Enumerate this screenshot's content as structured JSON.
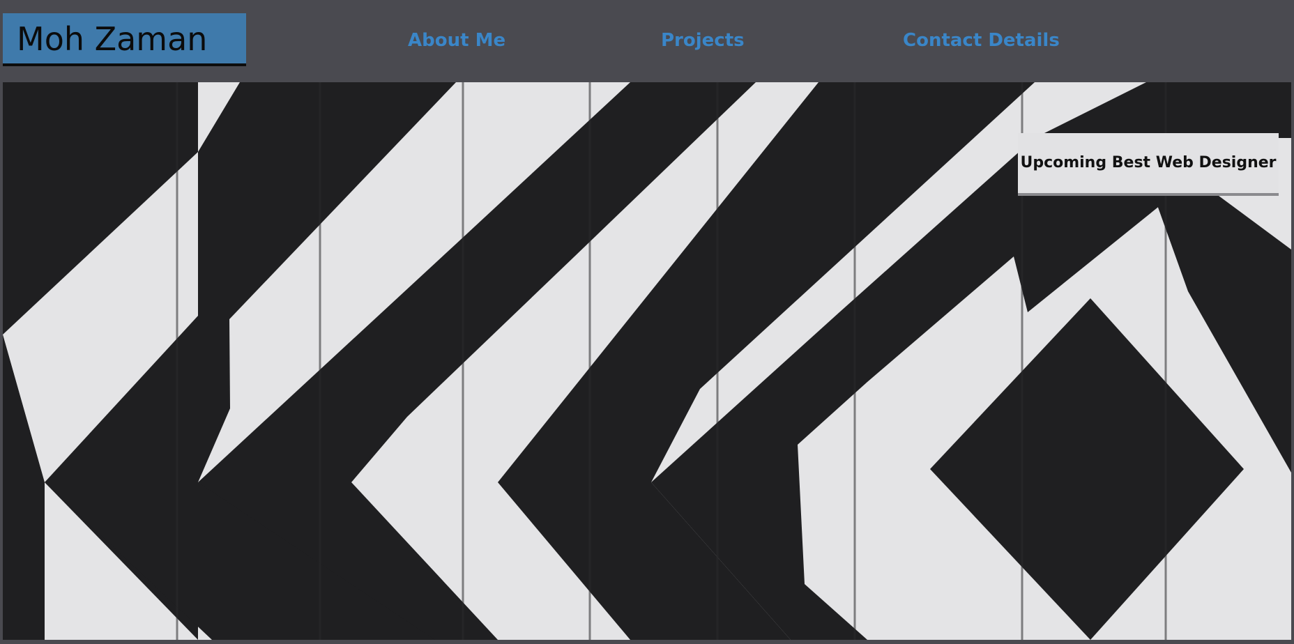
{
  "brand": {
    "name": "Moh Zaman"
  },
  "nav": {
    "items": [
      {
        "label": "About Me"
      },
      {
        "label": "Projects"
      },
      {
        "label": "Contact Details"
      }
    ]
  },
  "hero": {
    "image_description_icon": "black-white-chevron-wood-pattern",
    "tagline": "Upcoming Best Web Designer"
  },
  "colors": {
    "page_background": "#4a4a50",
    "brand_box": "#3f7aab",
    "nav_link": "#3a86c8",
    "pattern_dark": "#1f1f21",
    "pattern_light": "#e4e4e6"
  }
}
